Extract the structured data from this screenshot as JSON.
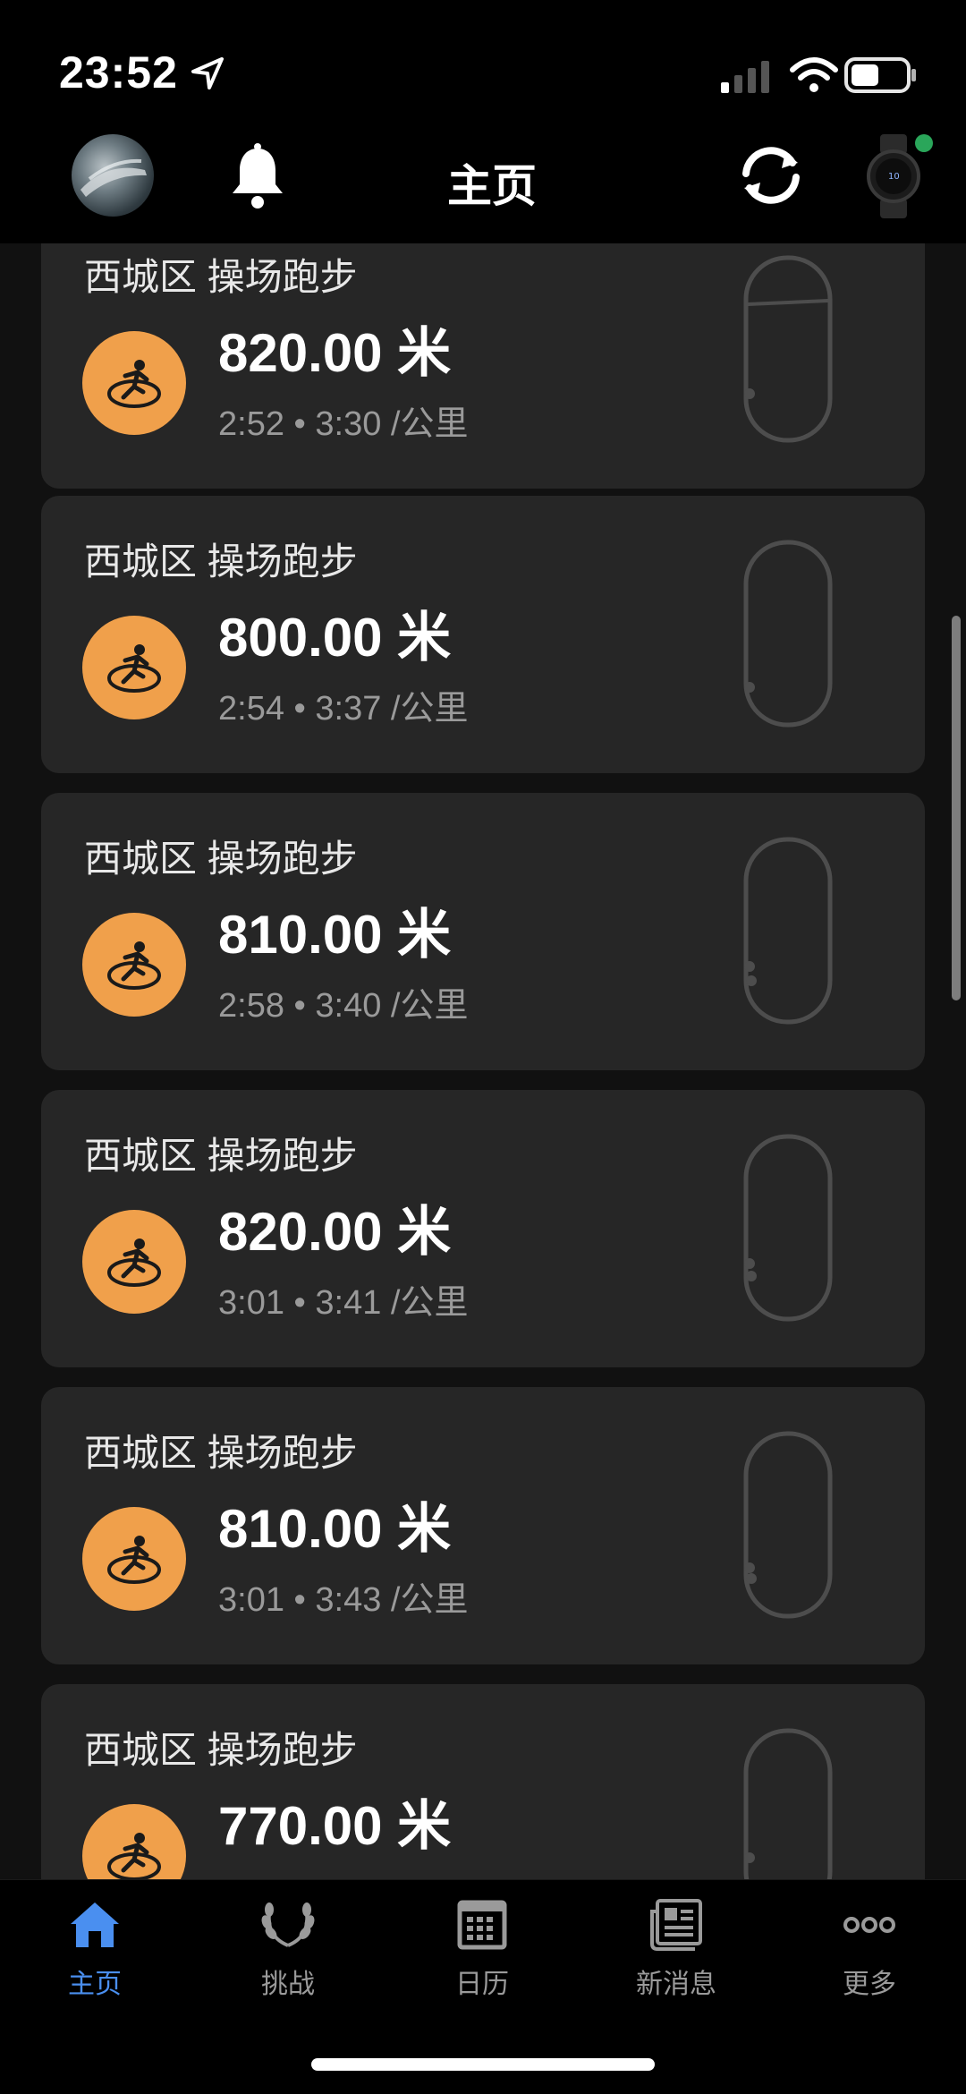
{
  "status_bar": {
    "time": "23:52"
  },
  "header": {
    "title": "主页"
  },
  "cards": [
    {
      "title": "西城区 操场跑步",
      "distance": "820.00 米",
      "meta": "2:52 • 3:30 /公里"
    },
    {
      "title": "西城区 操场跑步",
      "distance": "800.00 米",
      "meta": "2:54 • 3:37 /公里"
    },
    {
      "title": "西城区 操场跑步",
      "distance": "810.00 米",
      "meta": "2:58 • 3:40 /公里"
    },
    {
      "title": "西城区 操场跑步",
      "distance": "820.00 米",
      "meta": "3:01 • 3:41 /公里"
    },
    {
      "title": "西城区 操场跑步",
      "distance": "810.00 米",
      "meta": "3:01 • 3:43 /公里"
    },
    {
      "title": "西城区 操场跑步",
      "distance": "770.00 米",
      "meta": ""
    }
  ],
  "tabs": [
    {
      "label": "主页",
      "icon": "home-icon",
      "active": true
    },
    {
      "label": "挑战",
      "icon": "laurel-icon",
      "active": false
    },
    {
      "label": "日历",
      "icon": "calendar-icon",
      "active": false
    },
    {
      "label": "新消息",
      "icon": "newsfeed-icon",
      "active": false
    },
    {
      "label": "更多",
      "icon": "more-icon",
      "active": false
    }
  ],
  "colors": {
    "accent": "#4a8ff0",
    "badge": "#f0a04b",
    "card": "#262626"
  }
}
